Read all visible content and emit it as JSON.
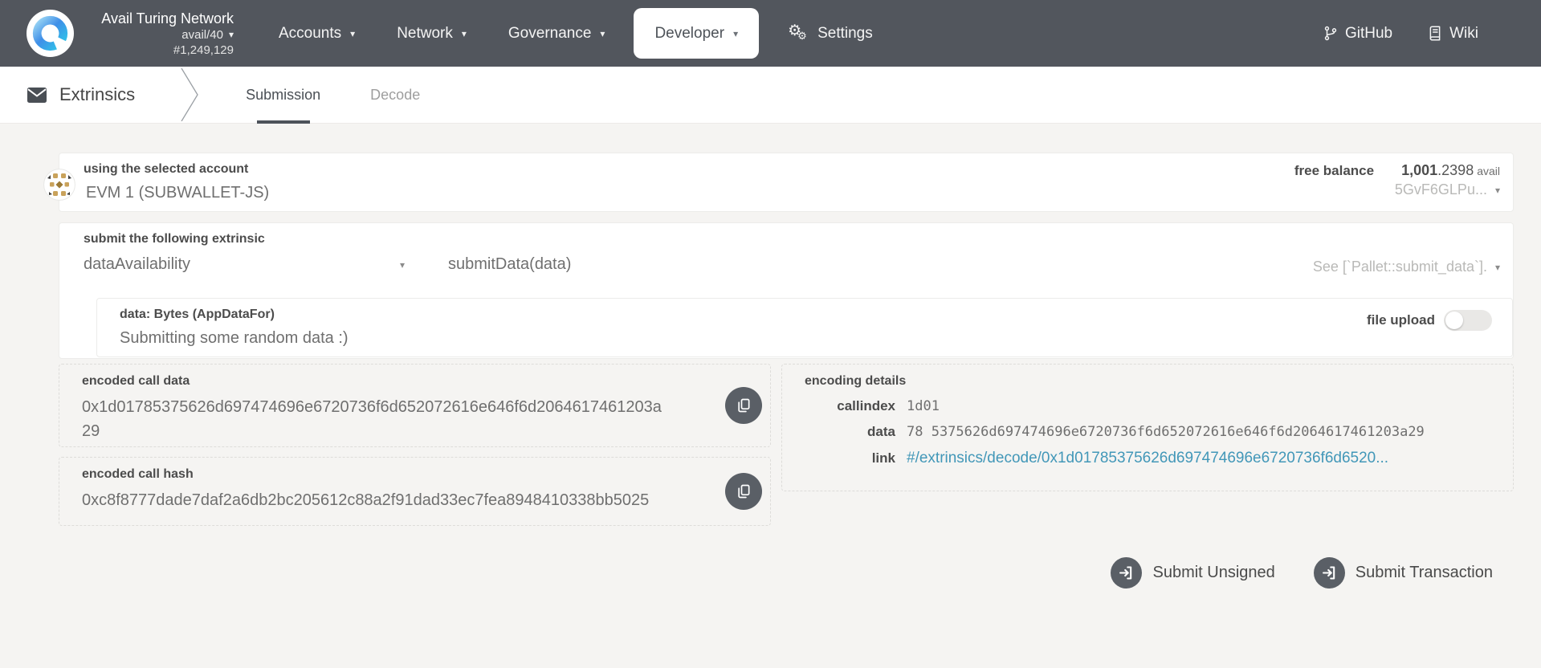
{
  "colors": {
    "navbar_bg": "#52565d",
    "page_bg": "#f5f4f2",
    "link": "#4297b8",
    "action_icon_bg": "#5a5f66",
    "tab_underline": "#4d525a"
  },
  "navbar": {
    "network_name": "Avail Turing Network",
    "chain_spec": "avail/40",
    "block_number": "#1,249,129",
    "menu": [
      {
        "label": "Accounts"
      },
      {
        "label": "Network"
      },
      {
        "label": "Governance"
      },
      {
        "label": "Developer",
        "active": true
      },
      {
        "label": "Settings"
      }
    ],
    "external_links": [
      {
        "label": "GitHub"
      },
      {
        "label": "Wiki"
      }
    ]
  },
  "tabbar": {
    "section_label": "Extrinsics",
    "tabs": [
      {
        "label": "Submission",
        "active": true
      },
      {
        "label": "Decode",
        "active": false
      }
    ]
  },
  "account_section": {
    "label": "using the selected account",
    "account_name": "EVM 1 (SUBWALLET-JS)",
    "free_balance_label": "free balance",
    "balance_int": "1,001",
    "balance_frac": ".2398",
    "balance_unit": "avail",
    "address_truncated": "5GvF6GLPu..."
  },
  "extrinsic_section": {
    "label": "submit the following extrinsic",
    "selected_pallet": "dataAvailability",
    "selected_method": "submitData(data)",
    "method_doc": "See [`Pallet::submit_data`]."
  },
  "data_param": {
    "label": "data: Bytes (AppDataFor)",
    "value": "Submitting some random data :)",
    "file_upload_label": "file upload",
    "file_upload_on": false
  },
  "outputs": {
    "encoded_call_data": {
      "label": "encoded call data",
      "value": "0x1d01785375626d697474696e6720736f6d652072616e646f6d2064617461203a29"
    },
    "encoded_call_hash": {
      "label": "encoded call hash",
      "value": "0xc8f8777dade7daf2a6db2bc205612c88a2f91dad33ec7fea8948410338bb5025"
    },
    "encoding_details": {
      "label": "encoding details",
      "callindex_label": "callindex",
      "callindex": "1d01",
      "data_label": "data",
      "data": "78 5375626d697474696e6720736f6d652072616e646f6d2064617461203a29",
      "link_label": "link",
      "link": "#/extrinsics/decode/0x1d01785375626d697474696e6720736f6d6520..."
    }
  },
  "actions": {
    "submit_unsigned": "Submit Unsigned",
    "submit_transaction": "Submit Transaction"
  }
}
